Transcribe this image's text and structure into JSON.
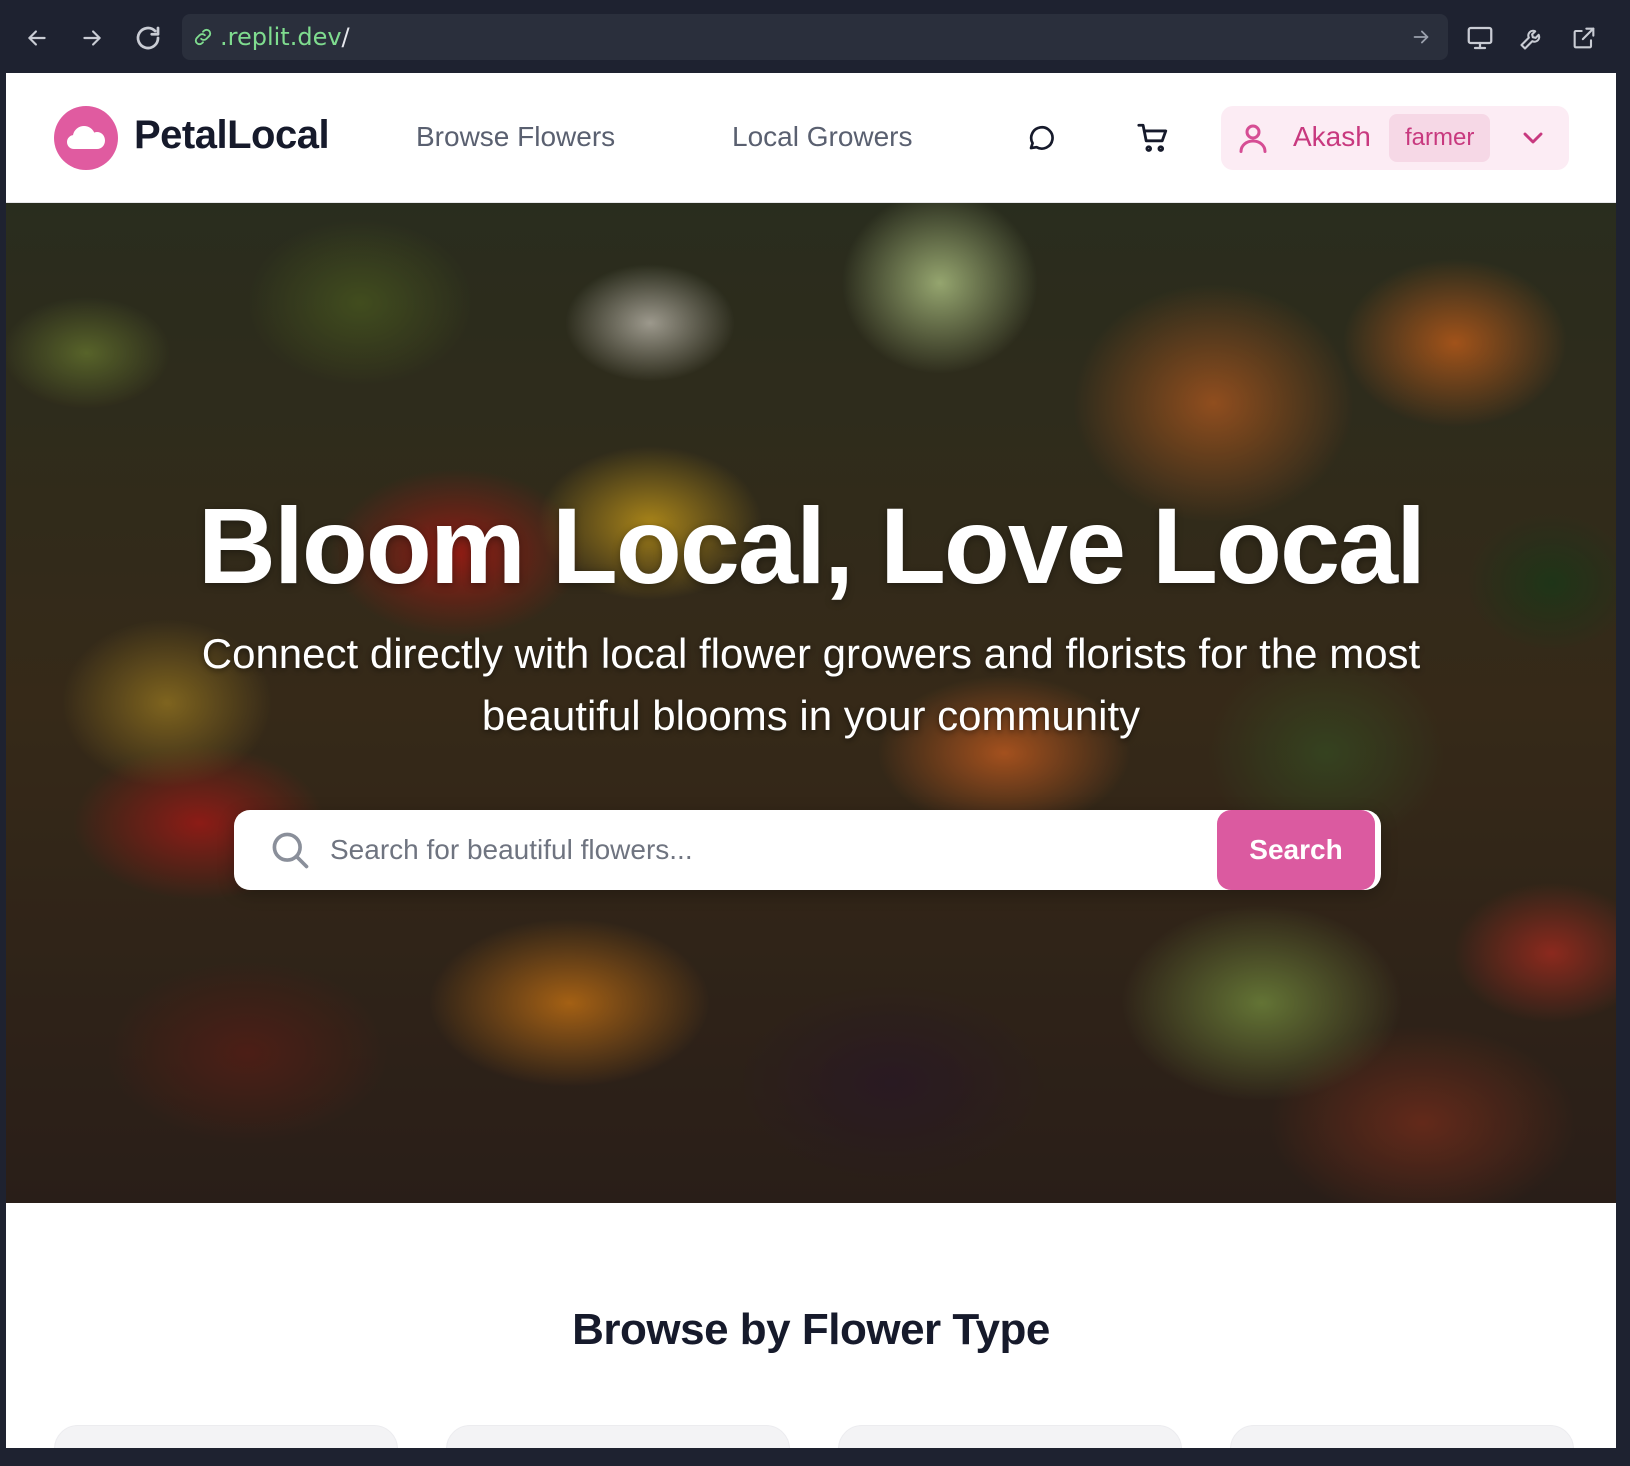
{
  "browser": {
    "url_host": ".replit.dev",
    "url_path": "/",
    "back_icon": "arrow-left-icon",
    "forward_icon": "arrow-right-icon",
    "reload_icon": "reload-icon",
    "link_icon": "link-icon",
    "go_icon": "arrow-right-icon",
    "device_icon": "monitor-icon",
    "tools_icon": "wrench-icon",
    "external_icon": "external-link-icon"
  },
  "header": {
    "brand": "PetalLocal",
    "nav": [
      "Browse Flowers",
      "Local Growers"
    ],
    "chat_icon": "chat-bubble-icon",
    "cart_icon": "shopping-cart-icon",
    "user": {
      "name": "Akash",
      "role": "farmer",
      "icon": "user-icon",
      "caret_icon": "chevron-down-icon"
    }
  },
  "hero": {
    "title": "Bloom Local, Love Local",
    "subtitle": "Connect directly with local flower growers and florists for the most beautiful blooms in your community",
    "search": {
      "placeholder": "Search for beautiful flowers...",
      "value": "",
      "button_label": "Search"
    }
  },
  "section": {
    "title": "Browse by Flower Type"
  },
  "colors": {
    "accent": "#db5aa0",
    "brand_logo": "#e05ba0",
    "user_pill_bg": "#fcecf4",
    "text_dark": "#161a2b"
  }
}
